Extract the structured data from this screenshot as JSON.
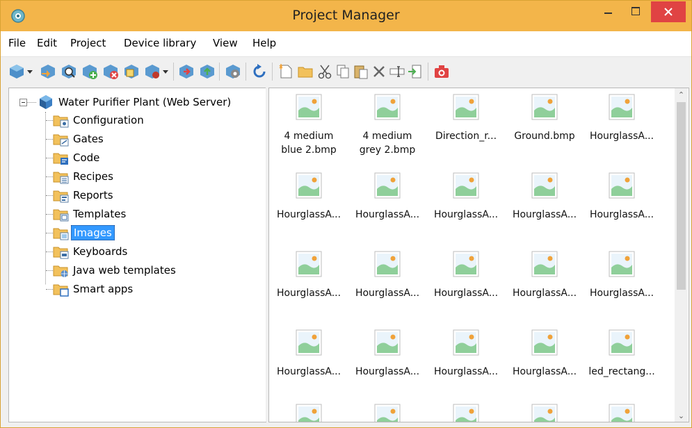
{
  "window": {
    "title": "Project Manager"
  },
  "menu": {
    "file": "File",
    "edit": "Edit",
    "project": "Project",
    "device_library": "Device library",
    "view": "View",
    "help": "Help"
  },
  "tree": {
    "root": "Water Purifier Plant (Web Server)",
    "items": [
      {
        "label": "Configuration",
        "icon": "configuration-folder-icon"
      },
      {
        "label": "Gates",
        "icon": "gates-folder-icon"
      },
      {
        "label": "Code",
        "icon": "code-folder-icon"
      },
      {
        "label": "Recipes",
        "icon": "recipes-folder-icon"
      },
      {
        "label": "Reports",
        "icon": "reports-folder-icon"
      },
      {
        "label": "Templates",
        "icon": "templates-folder-icon"
      },
      {
        "label": "Images",
        "icon": "images-folder-icon",
        "selected": true
      },
      {
        "label": "Keyboards",
        "icon": "keyboards-folder-icon"
      },
      {
        "label": "Java web templates",
        "icon": "java-web-templates-folder-icon"
      },
      {
        "label": "Smart apps",
        "icon": "smart-apps-folder-icon"
      }
    ]
  },
  "images": {
    "rows": [
      [
        [
          "4 medium",
          "blue 2.bmp"
        ],
        [
          "4 medium",
          "grey 2.bmp"
        ],
        [
          "Direction_r..."
        ],
        [
          "Ground.bmp"
        ],
        [
          "HourglassA..."
        ]
      ],
      [
        [
          "HourglassA..."
        ],
        [
          "HourglassA..."
        ],
        [
          "HourglassA..."
        ],
        [
          "HourglassA..."
        ],
        [
          "HourglassA..."
        ]
      ],
      [
        [
          "HourglassA..."
        ],
        [
          "HourglassA..."
        ],
        [
          "HourglassA..."
        ],
        [
          "HourglassA..."
        ],
        [
          "HourglassA..."
        ]
      ],
      [
        [
          "HourglassA..."
        ],
        [
          "HourglassA..."
        ],
        [
          "HourglassA..."
        ],
        [
          "HourglassA..."
        ],
        [
          "led_rectang..."
        ]
      ],
      [
        [
          ""
        ],
        [
          ""
        ],
        [
          ""
        ],
        [
          ""
        ],
        [
          ""
        ]
      ]
    ]
  },
  "colors": {
    "titlebar": "#f3b54a",
    "close": "#e04343",
    "selection": "#3399ff"
  }
}
